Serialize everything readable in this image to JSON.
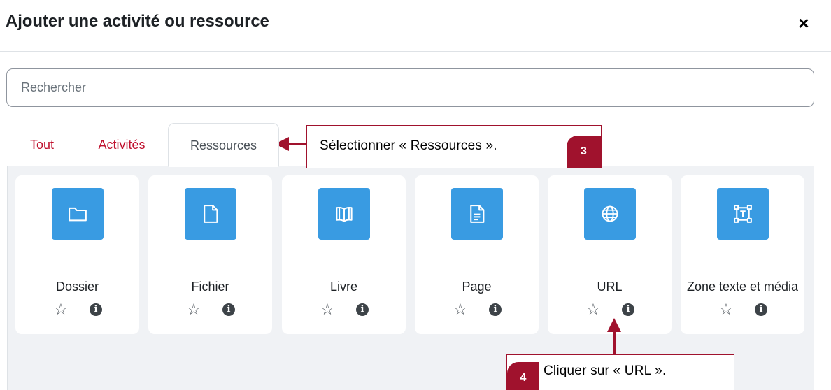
{
  "modal": {
    "title": "Ajouter une activité ou ressource",
    "close_label": "×"
  },
  "search": {
    "placeholder": "Rechercher",
    "value": ""
  },
  "tabs": [
    {
      "label": "Tout",
      "active": false
    },
    {
      "label": "Activités",
      "active": false
    },
    {
      "label": "Ressources",
      "active": true
    }
  ],
  "resources": [
    {
      "name": "Dossier",
      "icon": "folder-icon"
    },
    {
      "name": "Fichier",
      "icon": "file-icon"
    },
    {
      "name": "Livre",
      "icon": "book-icon"
    },
    {
      "name": "Page",
      "icon": "page-icon"
    },
    {
      "name": "URL",
      "icon": "globe-icon"
    },
    {
      "name": "Zone texte et média",
      "icon": "text-media-icon"
    }
  ],
  "card_actions": {
    "star": "☆",
    "info": "i"
  },
  "callouts": {
    "step3": {
      "text": "Sélectionner « Ressources ».",
      "number": "3"
    },
    "step4": {
      "text": "Cliquer sur « URL ».",
      "number": "4"
    }
  },
  "colors": {
    "accent": "#c0112e",
    "icon_bg": "#399be2",
    "callout": "#a0122d",
    "panel_bg": "#f0f2f5"
  }
}
